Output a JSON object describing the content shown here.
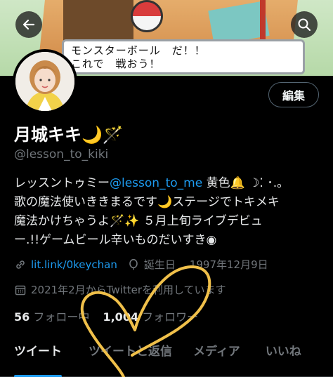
{
  "banner": {
    "dialog_line1": "モンスターボール　だ！！",
    "dialog_line2": "これで　戦おう！"
  },
  "profile": {
    "edit_label": "編集",
    "name": "月城キキ🌙🪄",
    "handle": "@lesson_to_kiki",
    "bio": {
      "line1_prefix": "レッスントゥミー",
      "line1_mention": "@lesson_to_me",
      "line1_suffix": " 黄色🔔 ☽⁚ ･.。",
      "line2": "歌の魔法使いききまるです🌙ステージでトキメキ",
      "line3": "魔法かけちゃうよ🪄✨ ５月上旬ライブデビュ",
      "line4": "ー.!!ゲームビール辛いものだいすき◉"
    },
    "link": "lit.link/0keychan",
    "birthday_label": "誕生日",
    "birthday": "1997年12月9日",
    "joined": "2021年2月からTwitterを利用しています",
    "following_count": "56",
    "following_label": "フォロー中",
    "followers_count": "1,004",
    "followers_label": "フォロワー"
  },
  "tabs": [
    "ツイート",
    "ツイートと返信",
    "メディア",
    "いいね"
  ],
  "colors": {
    "accent": "#1d9bf0",
    "muted": "#71767b",
    "heart": "#f0c04a"
  },
  "icons": [
    "back-arrow-icon",
    "search-icon",
    "link-icon",
    "balloon-icon",
    "calendar-icon"
  ]
}
